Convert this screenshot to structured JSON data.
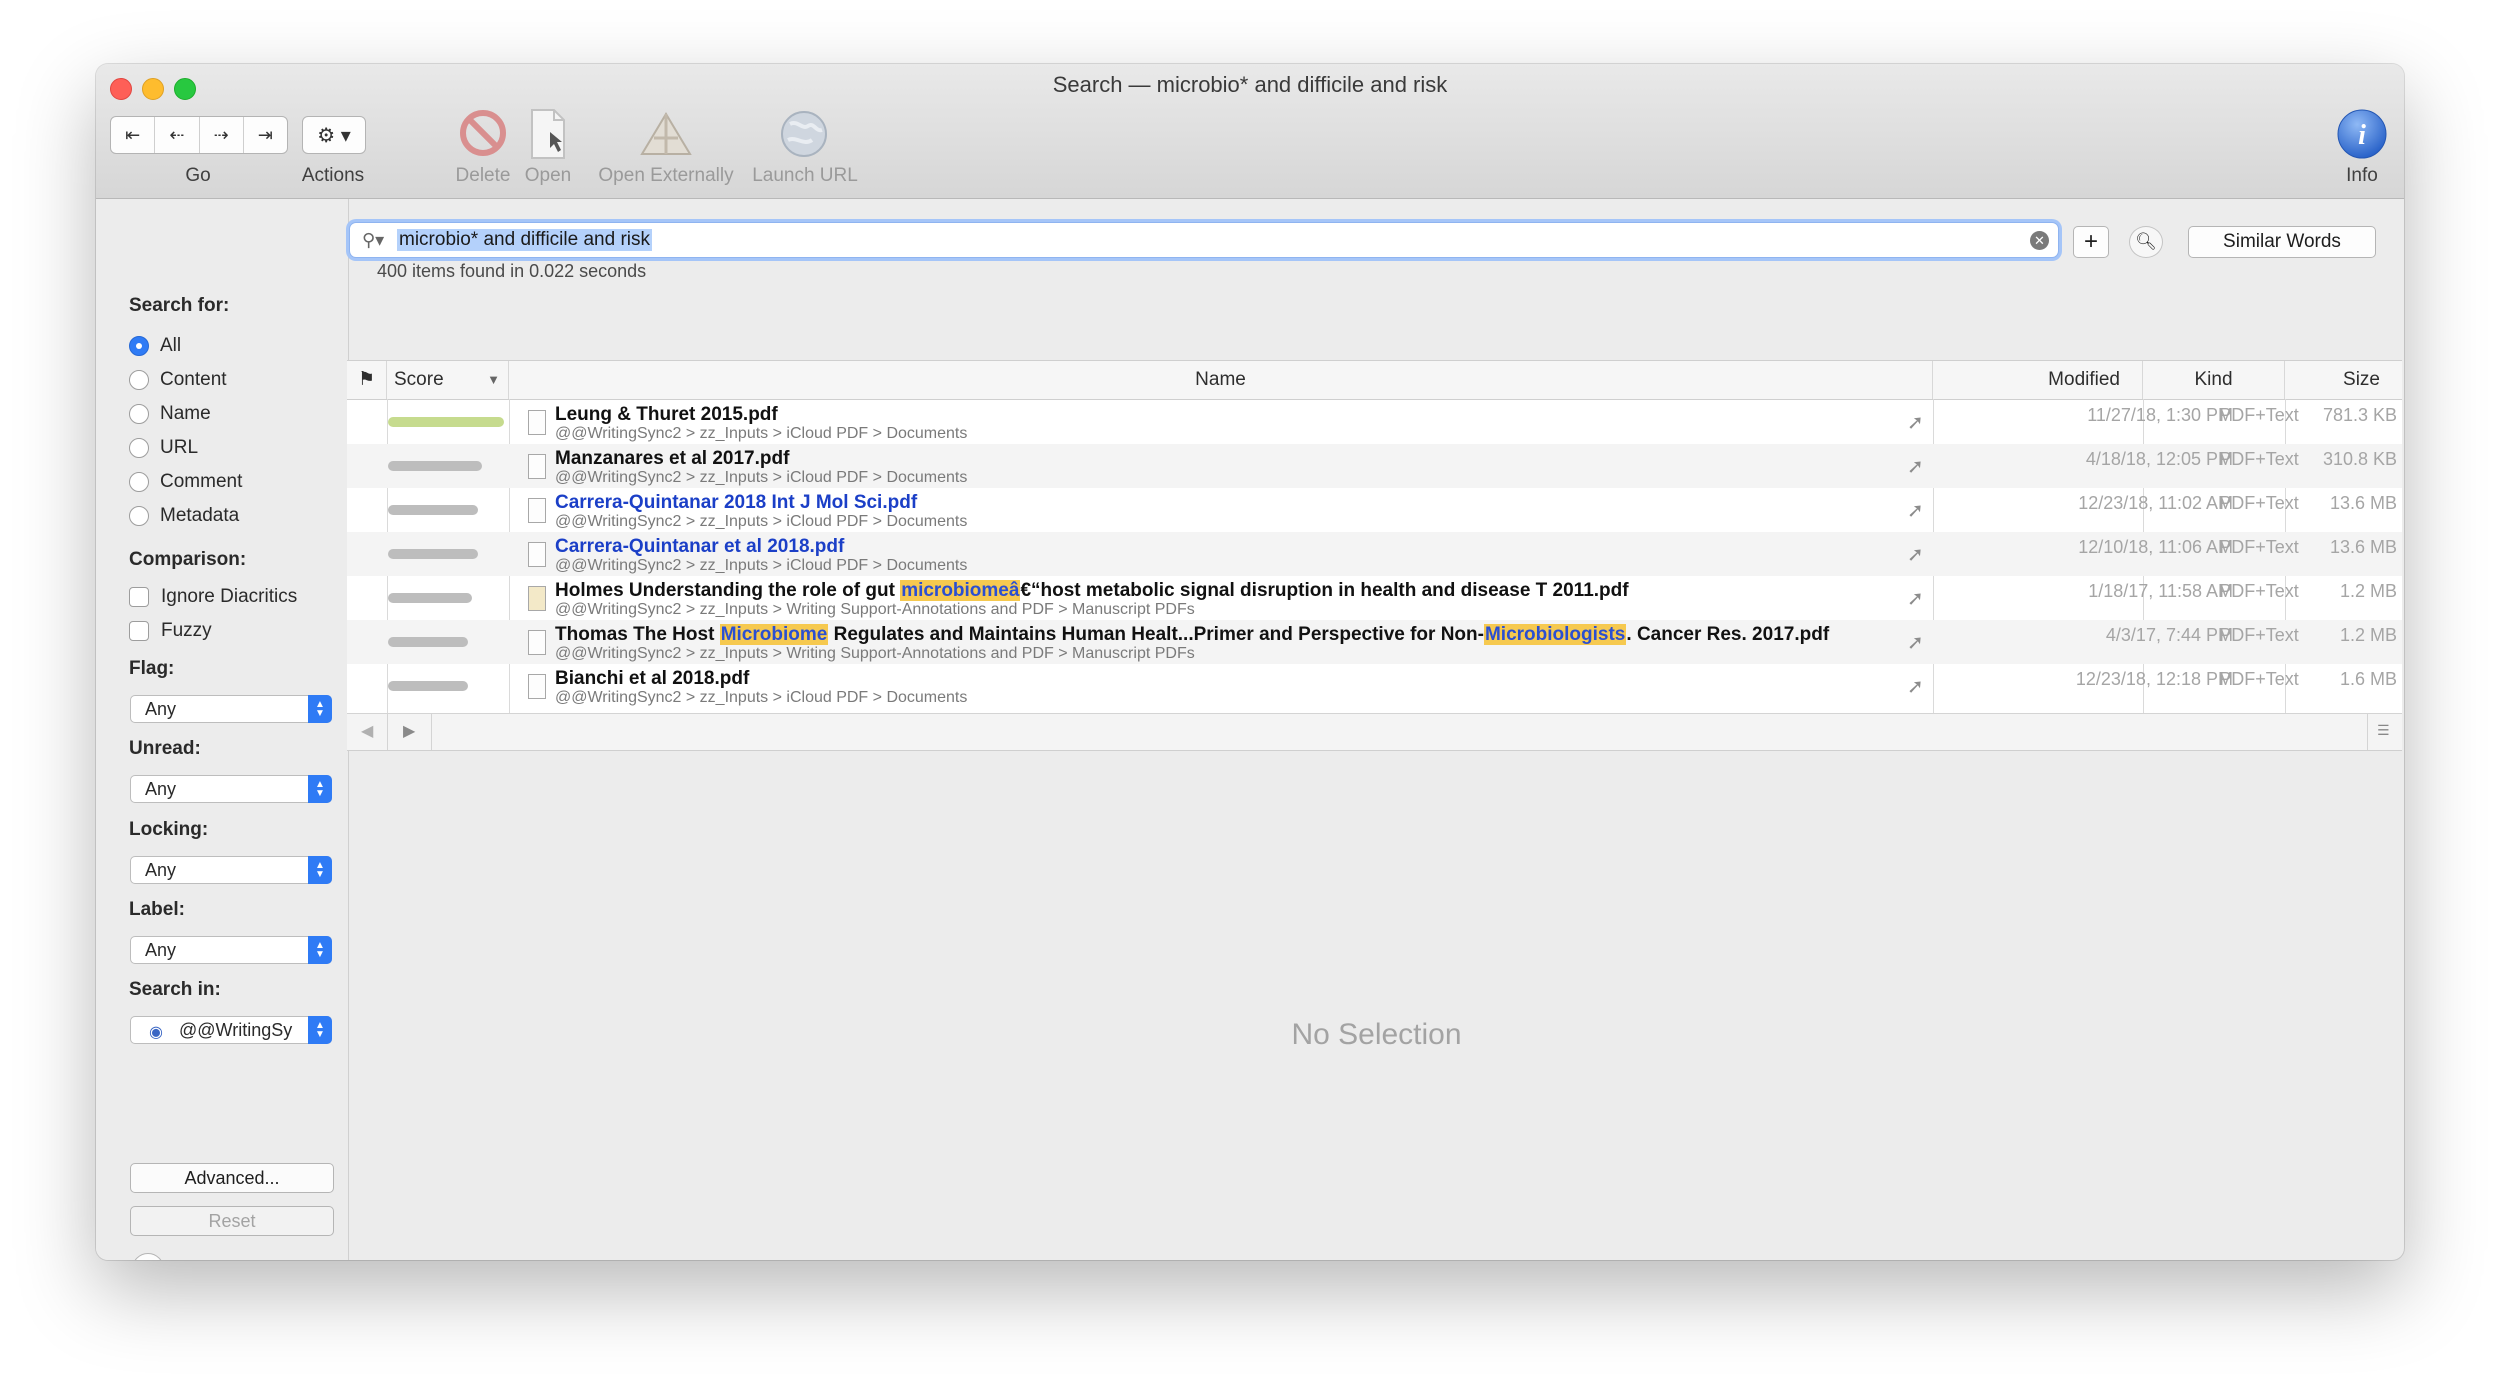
{
  "window": {
    "title": "Search — microbio* and difficile and risk"
  },
  "toolbar": {
    "go_label": "Go",
    "actions_label": "Actions",
    "delete_label": "Delete",
    "open_label": "Open",
    "open_externally_label": "Open Externally",
    "launch_url_label": "Launch URL",
    "info_label": "Info"
  },
  "sidebar": {
    "search_for": "Search for:",
    "search_options": [
      "All",
      "Content",
      "Name",
      "URL",
      "Comment",
      "Metadata"
    ],
    "comparison": "Comparison:",
    "comparison_options": [
      "Ignore Diacritics",
      "Fuzzy"
    ],
    "flag": "Flag:",
    "flag_value": "Any",
    "unread": "Unread:",
    "unread_value": "Any",
    "locking": "Locking:",
    "locking_value": "Any",
    "label": "Label:",
    "label_value": "Any",
    "search_in": "Search in:",
    "search_in_value": "@@WritingSy",
    "advanced": "Advanced...",
    "reset": "Reset",
    "help": "?"
  },
  "search": {
    "query": "microbio* and difficile and risk",
    "plus": "+",
    "similar_words": "Similar Words",
    "result_count": "400 items found in 0.022 seconds"
  },
  "table": {
    "headers": {
      "score": "Score",
      "name": "Name",
      "modified": "Modified",
      "kind": "Kind",
      "size": "Size"
    },
    "rows": [
      {
        "name": "Leung & Thuret 2015.pdf",
        "path": "@@WritingSync2 > zz_Inputs > iCloud PDF > Documents",
        "modified": "11/27/18, 1:30 PM",
        "kind": "PDF+Text",
        "size": "781.3 KB"
      },
      {
        "name": "Manzanares et al 2017.pdf",
        "path": "@@WritingSync2 > zz_Inputs > iCloud PDF > Documents",
        "modified": "4/18/18, 12:05 PM",
        "kind": "PDF+Text",
        "size": "310.8 KB"
      },
      {
        "name": "Carrera-Quintanar 2018 Int J Mol Sci.pdf",
        "path": "@@WritingSync2 > zz_Inputs > iCloud PDF > Documents",
        "modified": "12/23/18, 11:02 AM",
        "kind": "PDF+Text",
        "size": "13.6 MB"
      },
      {
        "name": "Carrera-Quintanar et al 2018.pdf",
        "path": "@@WritingSync2 > zz_Inputs > iCloud PDF > Documents",
        "modified": "12/10/18, 11:06 AM",
        "kind": "PDF+Text",
        "size": "13.6 MB"
      },
      {
        "name_pre": "Holmes Understanding the role of gut ",
        "name_hl": "microbiomeâ",
        "name_post": "€“host metabolic signal disruption in health and disease T 2011.pdf",
        "path": "@@WritingSync2 > zz_Inputs > Writing Support-Annotations and PDF > Manuscript PDFs",
        "modified": "1/18/17, 11:58 AM",
        "kind": "PDF+Text",
        "size": "1.2 MB"
      },
      {
        "name_pre": "Thomas The Host ",
        "name_hl": "Microbiome",
        "name_mid": " Regulates and Maintains Human Healt...Primer and Perspective for Non-",
        "name_hl2": "Microbiologists",
        "name_post": ". Cancer Res. 2017.pdf",
        "path": "@@WritingSync2 > zz_Inputs > Writing Support-Annotations and PDF > Manuscript PDFs",
        "modified": "4/3/17, 7:44 PM",
        "kind": "PDF+Text",
        "size": "1.2 MB"
      },
      {
        "name": "Bianchi et al 2018.pdf",
        "path": "@@WritingSync2 > zz_Inputs > iCloud PDF > Documents",
        "modified": "12/23/18, 12:18 PM",
        "kind": "PDF+Text",
        "size": "1.6 MB"
      }
    ]
  },
  "detail": {
    "no_selection": "No Selection"
  },
  "colors": {
    "accent": "#2f7bf5",
    "highlight": "#f6c94f",
    "link": "#1b3fc7"
  }
}
